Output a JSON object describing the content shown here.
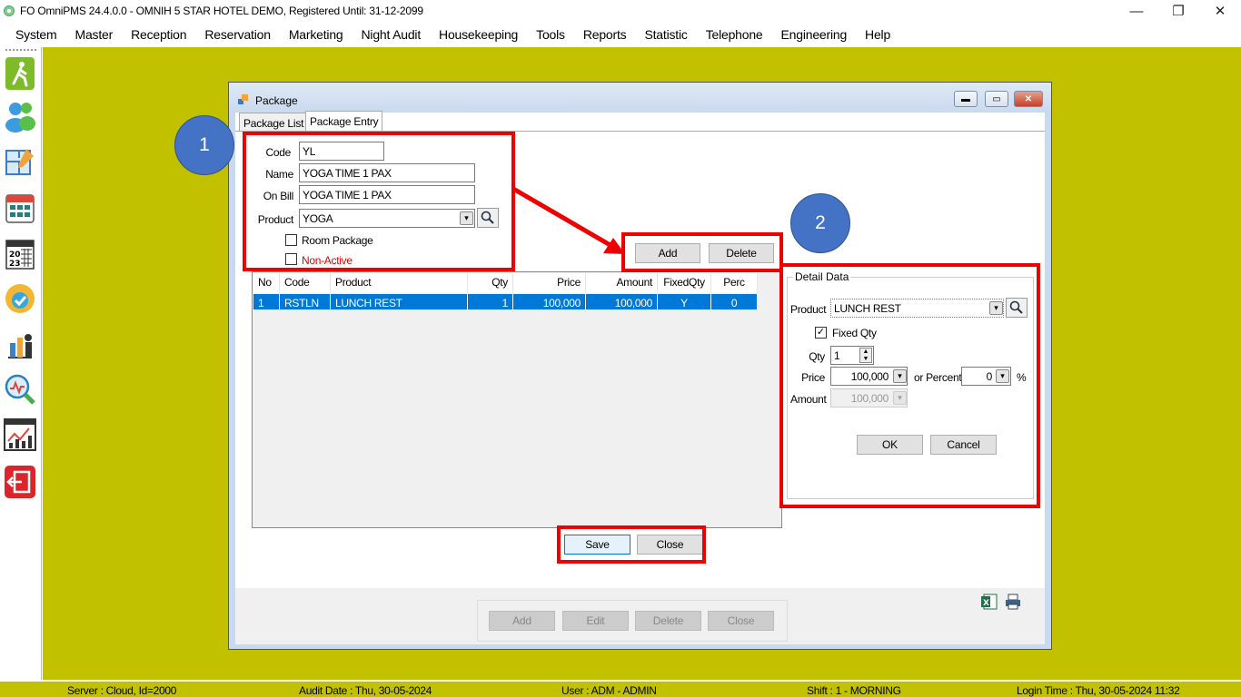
{
  "window": {
    "title": "FO OmniPMS 24.4.0.0 - OMNIH 5 STAR HOTEL DEMO, Registered Until: 31-12-2099",
    "minimize": "—",
    "restore": "❐",
    "close": "✕"
  },
  "menu": [
    "System",
    "Master",
    "Reception",
    "Reservation",
    "Marketing",
    "Night Audit",
    "Housekeeping",
    "Tools",
    "Reports",
    "Statistic",
    "Telephone",
    "Engineering",
    "Help"
  ],
  "sidebar_icons": [
    "walking-person-icon",
    "users-icon",
    "floor-plan-icon",
    "calendar-grid-icon",
    "calendar-2023-icon",
    "available-badge-icon",
    "housekeeping-icon",
    "search-analytics-icon",
    "chart-report-icon",
    "exit-icon"
  ],
  "package": {
    "title": "Package",
    "tabs": [
      "Package List",
      "Package Entry"
    ],
    "form": {
      "code_label": "Code",
      "code_value": "YL",
      "name_label": "Name",
      "name_value": "YOGA TIME 1 PAX",
      "onbill_label": "On Bill",
      "onbill_value": "YOGA TIME 1 PAX",
      "product_label": "Product",
      "product_value": "YOGA",
      "room_package_label": "Room Package",
      "non_active_label": "Non-Active"
    },
    "buttons": {
      "add": "Add",
      "delete": "Delete",
      "save": "Save",
      "close": "Close"
    },
    "grid": {
      "columns": [
        "No",
        "Code",
        "Product",
        "Qty",
        "Price",
        "Amount",
        "FixedQty",
        "Perc"
      ],
      "rows": [
        [
          "1",
          "RSTLN",
          "LUNCH REST",
          "1",
          "100,000",
          "100,000",
          "Y",
          "0"
        ]
      ]
    },
    "detail": {
      "title": "Detail Data",
      "product_label": "Product",
      "product_value": "LUNCH REST",
      "fixed_qty_label": "Fixed Qty",
      "qty_label": "Qty",
      "qty_value": "1",
      "price_label": "Price",
      "price_value": "100,000",
      "or_percent_label": "or Percent",
      "percent_value": "0",
      "percent_sign": "%",
      "amount_label": "Amount",
      "amount_value": "100,000",
      "ok": "OK",
      "cancel": "Cancel"
    },
    "list_buttons": {
      "add": "Add",
      "edit": "Edit",
      "delete": "Delete",
      "close": "Close"
    }
  },
  "annotations": {
    "step1": "1",
    "step2": "2",
    "color": "#e00000",
    "circle_color": "#4472c4"
  },
  "status": {
    "server": "Server : Cloud, Id=2000",
    "audit_date": "Audit Date : Thu, 30-05-2024",
    "user": "User : ADM - ADMIN",
    "shift": "Shift : 1 - MORNING",
    "login_time": "Login Time : Thu, 30-05-2024 11:32"
  },
  "colors": {
    "workspace": "#c1c100",
    "selection": "#0078d7",
    "non_active_text": "#e00000"
  }
}
